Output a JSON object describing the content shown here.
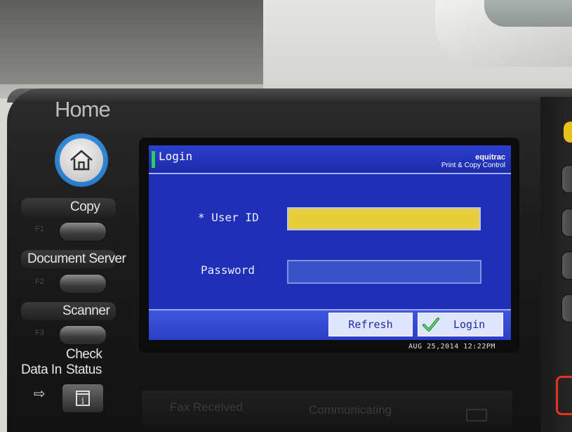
{
  "panel": {
    "home_label": "Home",
    "side_buttons": [
      {
        "label": "Copy",
        "fkey": "F1"
      },
      {
        "label": "Document Server",
        "fkey": "F2"
      },
      {
        "label": "Scanner",
        "fkey": "F3"
      }
    ],
    "data_in_label": "Data In",
    "check_status_label_line1": "Check",
    "check_status_label_line2": "Status"
  },
  "screen": {
    "title": "Login",
    "brand": "equitrac",
    "brand_subtitle": "Print & Copy Control",
    "user_id_label": "* User ID",
    "user_id_value": "",
    "password_label": "Password",
    "password_value": "",
    "refresh_label": "Refresh",
    "login_label": "Login",
    "datetime": "AUG  25,2014 12:22PM"
  },
  "lower_strip": {
    "fax_received": "Fax Received",
    "communicating": "Communicating"
  },
  "colors": {
    "screen_bg": "#1f2fb8",
    "userid_field": "#e6cf3a",
    "home_ring": "#1d6fc0",
    "status_green": "#29d05a",
    "stop_red": "#e3351f"
  }
}
